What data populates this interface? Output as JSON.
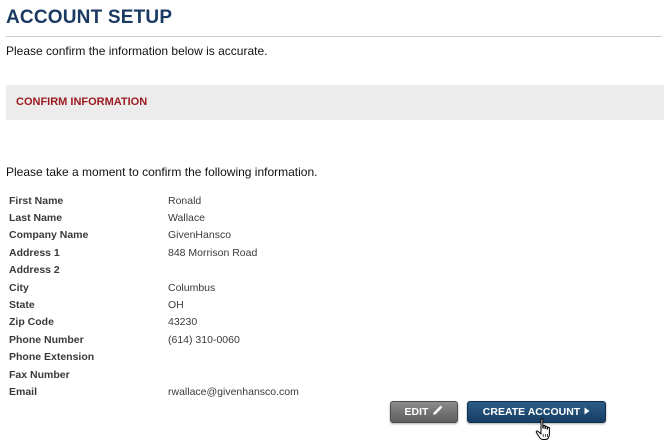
{
  "page": {
    "title": "ACCOUNT SETUP",
    "intro": "Please confirm the information below is accurate."
  },
  "section": {
    "title": "CONFIRM INFORMATION",
    "prompt": "Please take a moment to confirm the following information."
  },
  "fields": [
    {
      "label": "First Name",
      "value": "Ronald"
    },
    {
      "label": "Last Name",
      "value": "Wallace"
    },
    {
      "label": "Company Name",
      "value": "GivenHansco"
    },
    {
      "label": "Address 1",
      "value": "848 Morrison Road"
    },
    {
      "label": "Address 2",
      "value": ""
    },
    {
      "label": "City",
      "value": "Columbus"
    },
    {
      "label": "State",
      "value": "OH"
    },
    {
      "label": "Zip Code",
      "value": "43230"
    },
    {
      "label": "Phone Number",
      "value": "(614) 310-0060"
    },
    {
      "label": "Phone Extension",
      "value": ""
    },
    {
      "label": "Fax Number",
      "value": ""
    },
    {
      "label": "Email",
      "value": "rwallace@givenhansco.com"
    }
  ],
  "buttons": {
    "edit": {
      "label": "EDIT",
      "icon": "pencil-icon"
    },
    "create": {
      "label": "CREATE ACCOUNT",
      "icon": "arrow-right-icon"
    }
  },
  "cursor": {
    "icon": "hand-pointer-icon"
  },
  "colors": {
    "title": "#1b3a63",
    "section_title": "#9b1c22",
    "section_band": "#ececec",
    "edit_button": "#6e6e6e",
    "create_button": "#1f4b74"
  }
}
